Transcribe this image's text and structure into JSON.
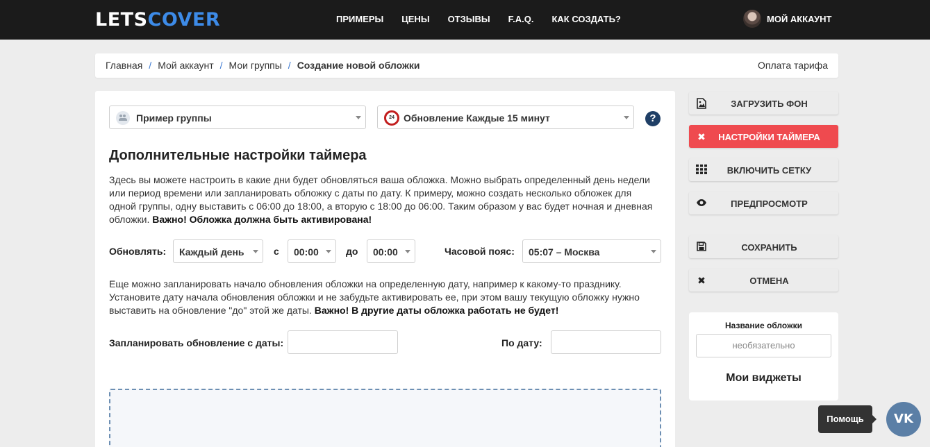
{
  "header": {
    "logo_left": "LETS",
    "logo_right": "COVER",
    "nav": [
      "ПРИМЕРЫ",
      "ЦЕНЫ",
      "ОТЗЫВЫ",
      "F.A.Q.",
      "КАК СОЗДАТЬ?"
    ],
    "account_label": "МОЙ АККАУНТ"
  },
  "breadcrumb": {
    "items": [
      "Главная",
      "Мой аккаунт",
      "Мои группы"
    ],
    "current": "Создание новой обложки",
    "separator": "/",
    "pay_link": "Оплата тарифа"
  },
  "main": {
    "group_select": "Пример группы",
    "update_select": "Обновление Каждые 15 минут",
    "update_icon_text": "24",
    "help_icon": "?",
    "title": "Дополнительные настройки таймера",
    "intro_text": "Здесь вы можете настроить в какие дни будет обновляться ваша обложка. Можно выбрать определенный день недели или период времени или запланировать обложку с даты по дату. К примеру, можно создать несколько обложек для одной группы, одну выставить с 06:00 до 18:00, а вторую с 18:00 до 06:00. Таким образом у вас будет ночная и дневная обложки.",
    "intro_bold": "Важно! Обложка должна быть активирована!",
    "update_label": "Обновлять:",
    "day_select": "Каждый день",
    "from_label": "с",
    "from_time": "00:00",
    "to_label": "до",
    "to_time": "00:00",
    "tz_label": "Часовой пояс:",
    "tz_select": "05:07 – Москва",
    "schedule_text": "Еще можно запланировать начало обновления обложки на определенную дату, например к какому-то празднику. Установите дату начала обновления обложки и не забудьте активировать ее, при этом вашу текущую обложку нужно выставить на обновление \"до\" этой же даты.",
    "schedule_bold": "Важно! В другие даты обложка работать не будет!",
    "date_from_label": "Запланировать обновление с даты:",
    "date_to_label": "По дату:",
    "date_from_value": "",
    "date_to_value": ""
  },
  "sidebar": {
    "buttons": [
      {
        "label": "ЗАГРУЗИТЬ ФОН",
        "icon": "image-icon"
      },
      {
        "label": "НАСТРОЙКИ ТАЙМЕРА",
        "icon": "close-icon"
      },
      {
        "label": "ВКЛЮЧИТЬ СЕТКУ",
        "icon": "grid-icon"
      },
      {
        "label": "ПРЕДПРОСМОТР",
        "icon": "eye-icon"
      },
      {
        "label": "СОХРАНИТЬ",
        "icon": "save-icon"
      },
      {
        "label": "ОТМЕНА",
        "icon": "close-icon"
      }
    ],
    "cover_name_label": "Название обложки",
    "cover_name_placeholder": "необязательно",
    "widgets_title": "Мои виджеты"
  },
  "help": {
    "tooltip": "Помощь",
    "vk_label": "VK"
  },
  "colors": {
    "header_bg": "#1b1b1b",
    "logo_accent": "#3d8be8",
    "active_button": "#ef4a4f",
    "help_circle": "#1f3f66",
    "vk_button": "#5b7fa6"
  }
}
